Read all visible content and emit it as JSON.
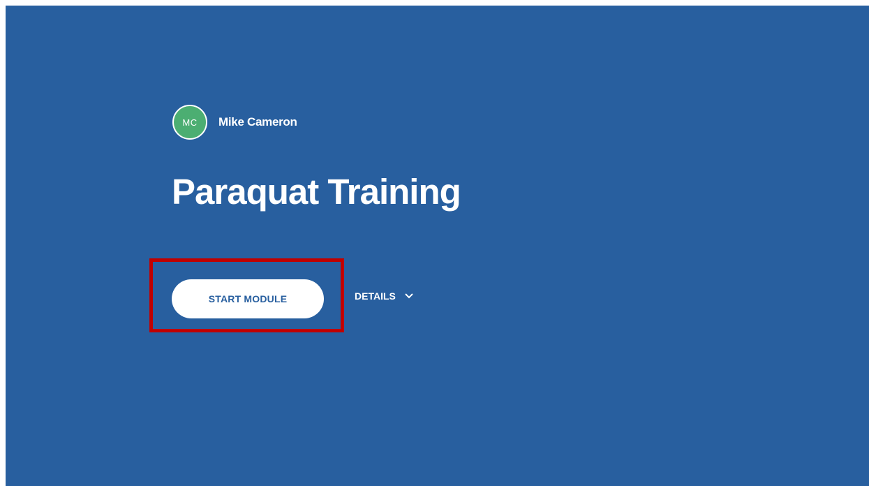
{
  "author": {
    "initials": "MC",
    "name": "Mike Cameron"
  },
  "module": {
    "title": "Paraquat Training"
  },
  "actions": {
    "start_label": "START MODULE",
    "details_label": "DETAILS",
    "details_icon": "chevron-down-icon"
  },
  "colors": {
    "background": "#285f9f",
    "avatar": "#4cae72",
    "highlight": "#c00000"
  }
}
